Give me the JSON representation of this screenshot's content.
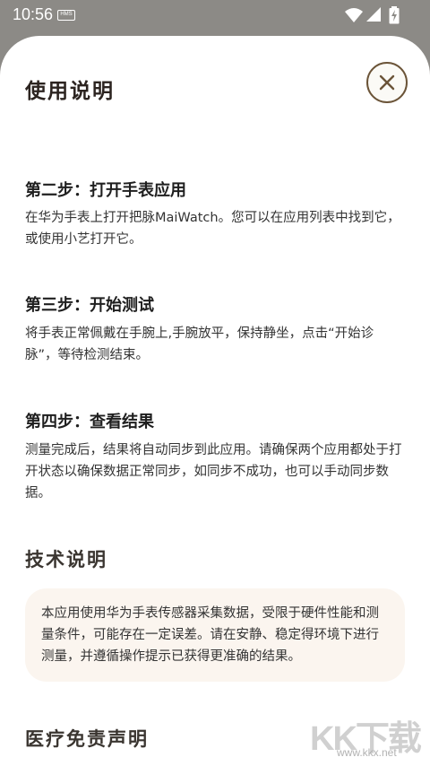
{
  "status_bar": {
    "time": "10:56",
    "hms_badge": "HMS"
  },
  "sheet": {
    "title": "使用说明",
    "close_icon": "close-icon",
    "steps": [
      {
        "title": "第二步：打开手表应用",
        "body": "在华为手表上打开把脉MaiWatch。您可以在应用列表中找到它，或使用小艺打开它。"
      },
      {
        "title": "第三步：开始测试",
        "body": "将手表正常佩戴在手腕上,手腕放平，保持静坐，点击“开始诊脉”，等待检测结束。"
      },
      {
        "title": "第四步：查看结果",
        "body": "测量完成后，结果将自动同步到此应用。请确保两个应用都处于打开状态以确保数据正常同步，如同步不成功，也可以手动同步数据。"
      }
    ],
    "tech_section": {
      "title": "技术说明",
      "body": "本应用使用华为手表传感器采集数据，受限于硬件性能和测量条件，可能存在一定误差。请在安静、稳定得环境下进行测量，并遵循操作提示已获得更准确的结果。"
    },
    "disclaimer_section": {
      "title": "医疗免责声明"
    }
  },
  "watermark": {
    "logo_text": "KK下载",
    "url": "www.kkx.net"
  },
  "colors": {
    "accent_brown": "#6b5438",
    "card_bg": "#fbf5ef"
  }
}
